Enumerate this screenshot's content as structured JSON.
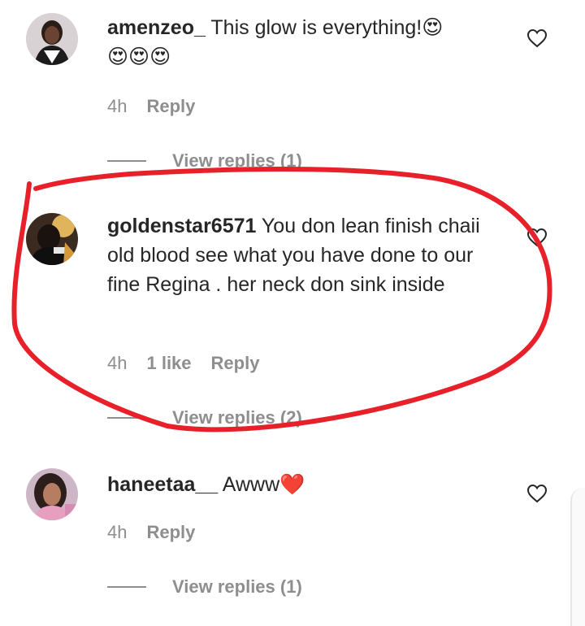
{
  "comments": [
    {
      "username": "amenzeo_",
      "text": "This glow is everything!😍",
      "text_line2": "😍😍😍",
      "time": "4h",
      "likes": "",
      "reply_label": "Reply",
      "view_replies": "View replies (1)"
    },
    {
      "username": "goldenstar6571",
      "text": "You don lean finish chaii old blood see what you have done to our fine Regina . her neck don sink inside",
      "time": "4h",
      "likes": "1 like",
      "reply_label": "Reply",
      "view_replies": "View replies (2)"
    },
    {
      "username": "haneetaa__",
      "text": "Awww❤️",
      "time": "4h",
      "likes": "",
      "reply_label": "Reply",
      "view_replies": "View replies (1)"
    }
  ],
  "icons": {
    "like": "heart-outline-icon"
  },
  "colors": {
    "text": "#262626",
    "meta": "#8e8e8e",
    "annotation": "#e8202a"
  }
}
